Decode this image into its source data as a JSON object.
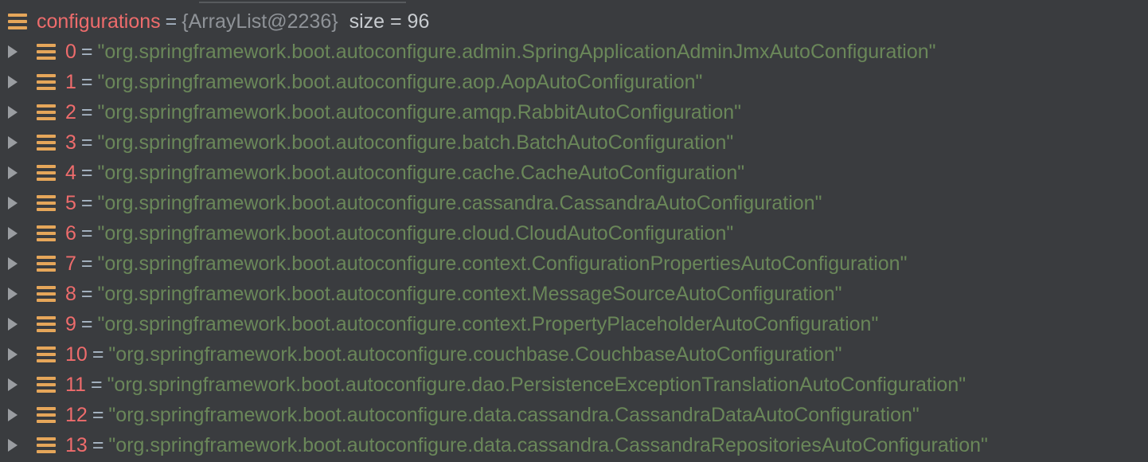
{
  "variable": {
    "name": "configurations",
    "type": "{ArrayList@2236}",
    "size_text": "size = 96"
  },
  "operator": "=",
  "items": [
    {
      "index": "0",
      "value": "\"org.springframework.boot.autoconfigure.admin.SpringApplicationAdminJmxAutoConfiguration\""
    },
    {
      "index": "1",
      "value": "\"org.springframework.boot.autoconfigure.aop.AopAutoConfiguration\""
    },
    {
      "index": "2",
      "value": "\"org.springframework.boot.autoconfigure.amqp.RabbitAutoConfiguration\""
    },
    {
      "index": "3",
      "value": "\"org.springframework.boot.autoconfigure.batch.BatchAutoConfiguration\""
    },
    {
      "index": "4",
      "value": "\"org.springframework.boot.autoconfigure.cache.CacheAutoConfiguration\""
    },
    {
      "index": "5",
      "value": "\"org.springframework.boot.autoconfigure.cassandra.CassandraAutoConfiguration\""
    },
    {
      "index": "6",
      "value": "\"org.springframework.boot.autoconfigure.cloud.CloudAutoConfiguration\""
    },
    {
      "index": "7",
      "value": "\"org.springframework.boot.autoconfigure.context.ConfigurationPropertiesAutoConfiguration\""
    },
    {
      "index": "8",
      "value": "\"org.springframework.boot.autoconfigure.context.MessageSourceAutoConfiguration\""
    },
    {
      "index": "9",
      "value": "\"org.springframework.boot.autoconfigure.context.PropertyPlaceholderAutoConfiguration\""
    },
    {
      "index": "10",
      "value": "\"org.springframework.boot.autoconfigure.couchbase.CouchbaseAutoConfiguration\""
    },
    {
      "index": "11",
      "value": "\"org.springframework.boot.autoconfigure.dao.PersistenceExceptionTranslationAutoConfiguration\""
    },
    {
      "index": "12",
      "value": "\"org.springframework.boot.autoconfigure.data.cassandra.CassandraDataAutoConfiguration\""
    },
    {
      "index": "13",
      "value": "\"org.springframework.boot.autoconfigure.data.cassandra.CassandraRepositoriesAutoConfiguration\""
    }
  ],
  "colors": {
    "background": "#3a3c3f",
    "field_icon": "#e5a65a",
    "variable_name": "#ee6c6c",
    "string_value": "#6a8759",
    "type_text": "#8f9398"
  },
  "icons": {
    "expander": "triangle-right-icon",
    "field": "field-icon"
  }
}
